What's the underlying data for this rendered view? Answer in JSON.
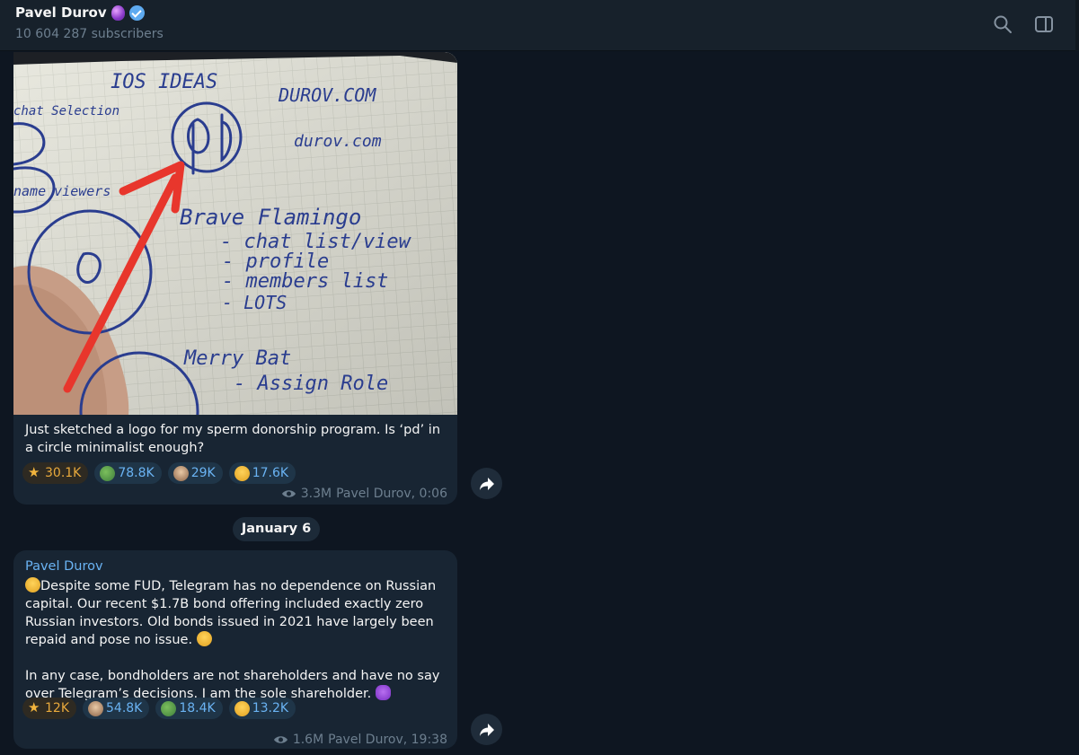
{
  "header": {
    "channel_name": "Pavel Durov",
    "subscribers": "10 604 287 subscribers",
    "icons": [
      "search-icon",
      "sidebar-toggle-icon"
    ]
  },
  "messages": [
    {
      "photo_icon": "notebook-sketch-photo",
      "photo_text": {
        "ios_ideas": "IOS IDEAS",
        "durov_com": "DUROV.COM",
        "durov_com_script": "durov.com",
        "chat_selection": "chat Selection",
        "name_viewers": "name viewers",
        "brave_flamingo": "Brave Flamingo",
        "chat_list_view": "- chat list/view",
        "profile": "- profile",
        "members_list": "- members list",
        "lots": "- LOTS",
        "merry_bat": "Merry Bat",
        "assign_role": "- Assign Role"
      },
      "text": "Just sketched a logo for my sperm donorship program. Is ‘pd’ in a circle minimalist enough?",
      "reactions": [
        {
          "icon": "star-icon",
          "count": "30.1K"
        },
        {
          "icon": "frog-icon",
          "count": "78.8K"
        },
        {
          "icon": "man-icon",
          "count": "29K"
        },
        {
          "icon": "crying-laugh-icon",
          "count": "17.6K"
        }
      ],
      "views": "3.3M",
      "signature": "Pavel Durov, 0:06"
    },
    {
      "sender": "Pavel Durov",
      "paragraph1": "Despite some FUD, Telegram has no dependence on Russian capital. Our recent $1.7B bond offering included exactly zero Russian investors. Old bonds issued in 2021 have largely been repaid and pose no issue.",
      "paragraph2": "In any case, bondholders are not shareholders and have no say over Telegram’s decisions. I am the sole shareholder.",
      "reactions": [
        {
          "icon": "star-icon",
          "count": "12K"
        },
        {
          "icon": "man-icon",
          "count": "54.8K"
        },
        {
          "icon": "frog-icon",
          "count": "18.4K"
        },
        {
          "icon": "crying-laugh-icon",
          "count": "13.2K"
        }
      ],
      "views": "1.6M",
      "signature": "Pavel Durov, 19:38"
    }
  ],
  "date_separator": "January 6",
  "colors": {
    "background": "#0e1621",
    "header": "#17212b",
    "bubble": "#182533",
    "accent": "#6ab3f3",
    "muted": "#6d7f8f",
    "star": "#e8a93c"
  }
}
